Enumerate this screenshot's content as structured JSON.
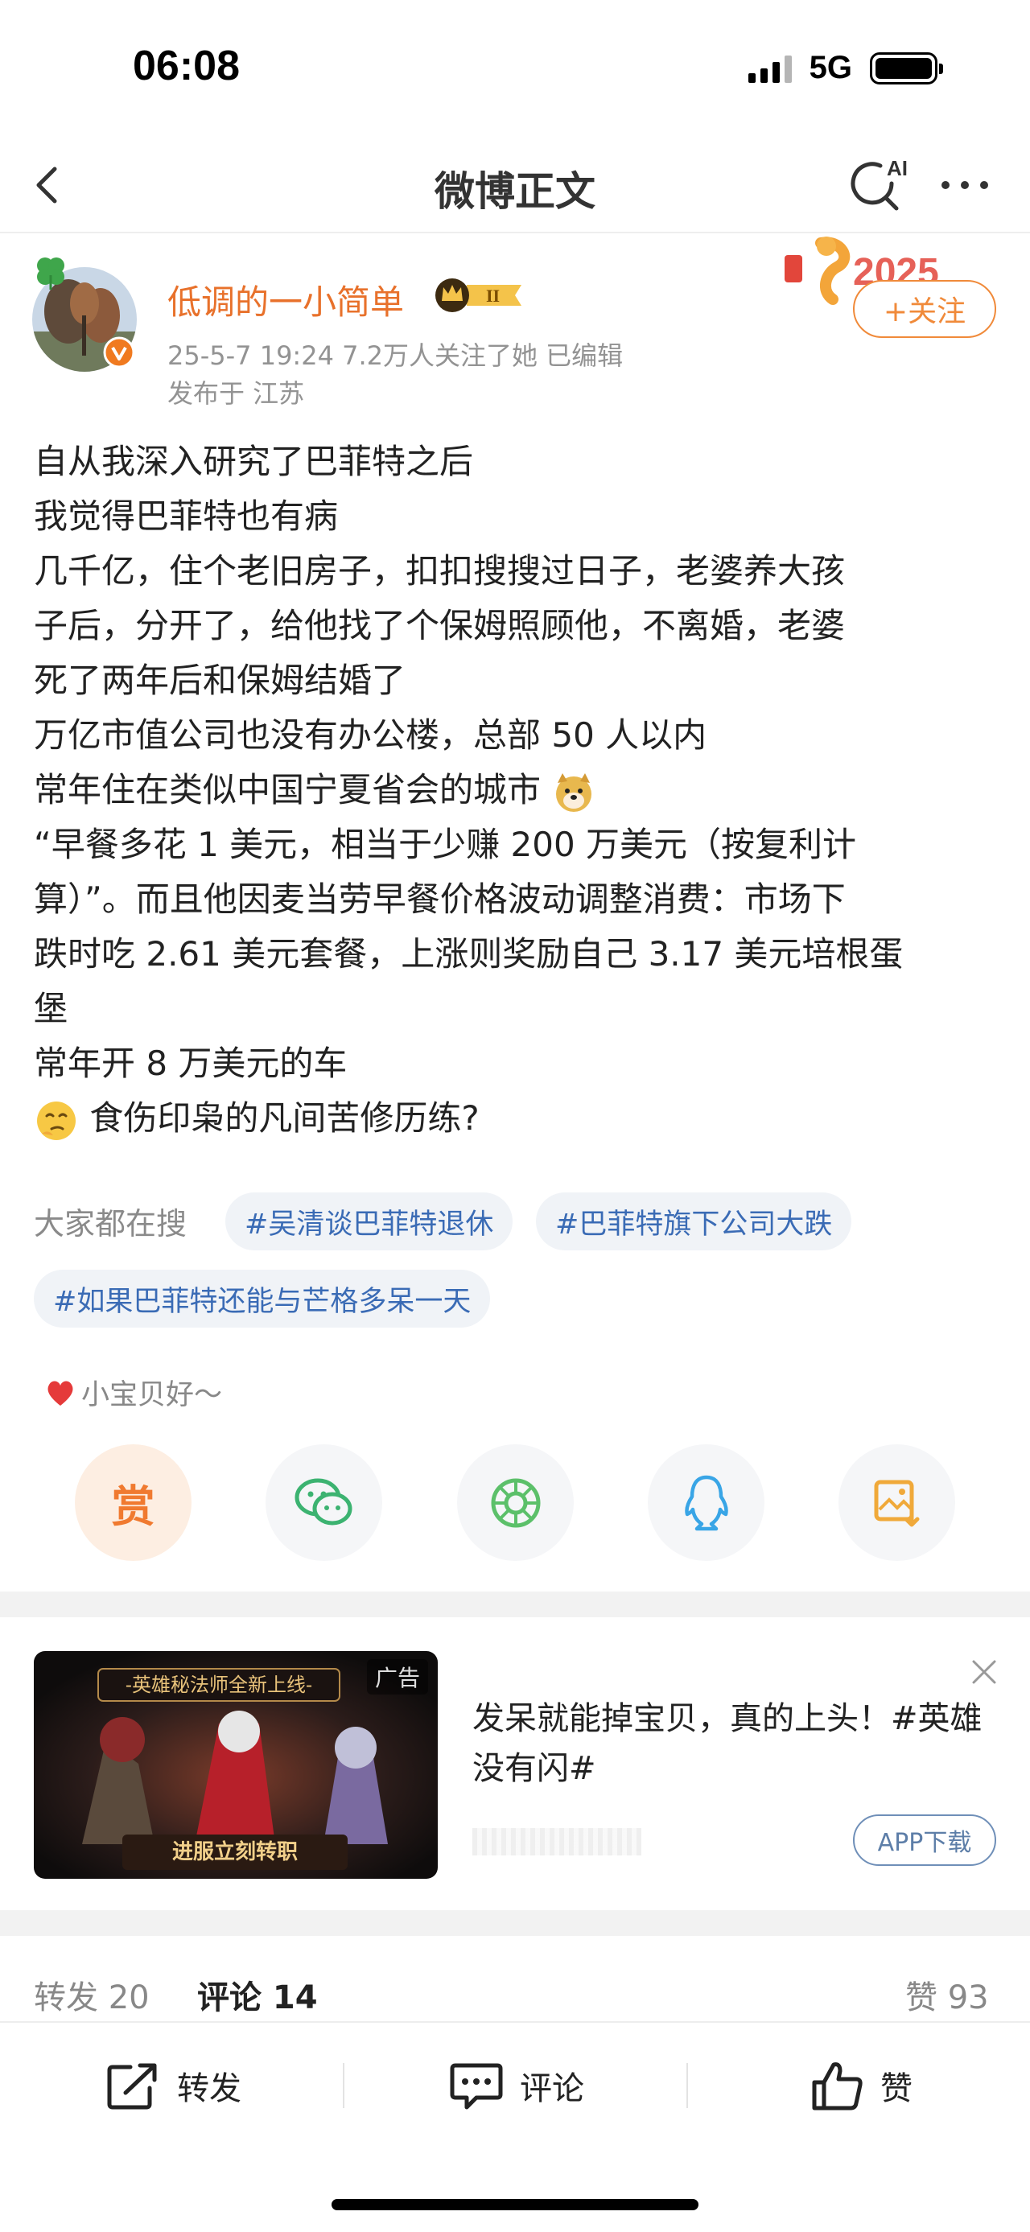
{
  "status_bar": {
    "time": "06:08",
    "network": "5G"
  },
  "nav": {
    "title": "微博正文",
    "ai_label": "AI"
  },
  "author": {
    "name": "低调的一小简单",
    "vip_level": "II",
    "meta": "25-5-7 19:24  7.2万人关注了她  已编辑",
    "location": "发布于 江苏",
    "follow_label": "+关注",
    "deco_text": "2025"
  },
  "post": {
    "lines": [
      "自从我深入研究了巴菲特之后",
      "我觉得巴菲特也有病",
      "几千亿，住个老旧房子，扣扣搜搜过日子，老婆养大孩",
      "子后，分开了，给他找了个保姆照顾他，不离婚，老婆",
      "死了两年后和保姆结婚了",
      "万亿市值公司也没有办公楼，总部 50 人以内",
      "常年住在类似中国宁夏省会的城市",
      "“早餐多花 1 美元，相当于少赚 200 万美元（按复利计",
      "算）”。而且他因麦当劳早餐价格波动调整消费：市场下",
      "跌时吃 2.61 美元套餐，上涨则奖励自己 3.17 美元培根蛋",
      "堡",
      "常年开 8 万美元的车",
      "食伤印枭的凡间苦修历练?"
    ],
    "emoji_doge": "doge-emoji",
    "emoji_think": "thinking-emoji"
  },
  "hot_search": {
    "label": "大家都在搜",
    "tags": [
      "#吴清谈巴菲特退休",
      "#巴菲特旗下公司大跌",
      "#如果巴菲特还能与芒格多呆一天"
    ]
  },
  "reward": {
    "tip": "小宝贝好～",
    "button_label": "赏"
  },
  "share": [
    "reward-icon",
    "wechat-icon",
    "moments-icon",
    "qq-icon",
    "save-image-icon"
  ],
  "ad": {
    "tag": "广告",
    "banner_title": "-英雄秘法师全新上线-",
    "banner_sub": "进服立刻转职",
    "title": "发呆就能掉宝贝，真的上头！#英雄没有闪#",
    "download_label": "APP下载"
  },
  "stats": {
    "repost": "转发 20",
    "comment": "评论 14",
    "like": "赞 93"
  },
  "actions": {
    "repost": "转发",
    "comment": "评论",
    "like": "赞"
  },
  "colors": {
    "accent": "#f08a3a",
    "name": "#e8712b",
    "link": "#3a6bb5"
  }
}
